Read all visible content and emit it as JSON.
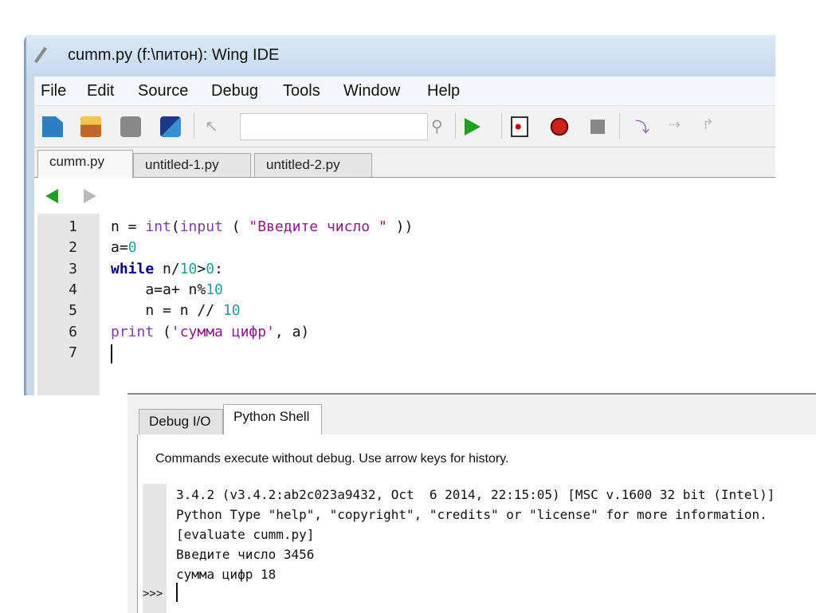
{
  "window": {
    "title": "cumm.py (f:\\питон): Wing IDE"
  },
  "menu": [
    "File",
    "Edit",
    "Source",
    "Debug",
    "Tools",
    "Window",
    "Help"
  ],
  "toolbar": {
    "search_value": ""
  },
  "tabs": [
    {
      "label": "cumm.py",
      "active": true
    },
    {
      "label": "untitled-1.py"
    },
    {
      "label": "untitled-2.py"
    }
  ],
  "editor": {
    "line_numbers": [
      "1",
      "2",
      "3",
      "4",
      "5",
      "6",
      "7"
    ],
    "lines": [
      [
        [
          "op",
          "n = "
        ],
        [
          "bi",
          "int"
        ],
        [
          "op",
          "("
        ],
        [
          "bi",
          "input"
        ],
        [
          "op",
          " ( "
        ],
        [
          "str",
          "\"Введите число \""
        ],
        [
          "op",
          " ))"
        ]
      ],
      [
        [
          "op",
          "a="
        ],
        [
          "num",
          "0"
        ]
      ],
      [
        [
          "kw",
          "while"
        ],
        [
          "op",
          " n/"
        ],
        [
          "num",
          "10"
        ],
        [
          "op",
          ">"
        ],
        [
          "num",
          "0"
        ],
        [
          "op",
          ":"
        ]
      ],
      [
        [
          "op",
          "    a=a+ n%"
        ],
        [
          "num",
          "10"
        ]
      ],
      [
        [
          "op",
          "    n = n // "
        ],
        [
          "num",
          "10"
        ]
      ],
      [
        [
          "bi",
          "print"
        ],
        [
          "op",
          " ("
        ],
        [
          "str",
          "'сумма цифр'"
        ],
        [
          "op",
          ", a)"
        ]
      ],
      []
    ]
  },
  "shell": {
    "tabs": [
      {
        "label": "Debug I/O"
      },
      {
        "label": "Python Shell",
        "active": true
      }
    ],
    "message": "Commands execute without debug.  Use arrow keys for history.",
    "output": [
      "3.4.2 (v3.4.2:ab2c023a9432, Oct  6 2014, 22:15:05) [MSC v.1600 32 bit (Intel)]",
      "Python Type \"help\", \"copyright\", \"credits\" or \"license\" for more information.",
      "[evaluate cumm.py]",
      "Введите число 3456",
      "сумма цифр 18"
    ],
    "prompt": ">>>"
  }
}
